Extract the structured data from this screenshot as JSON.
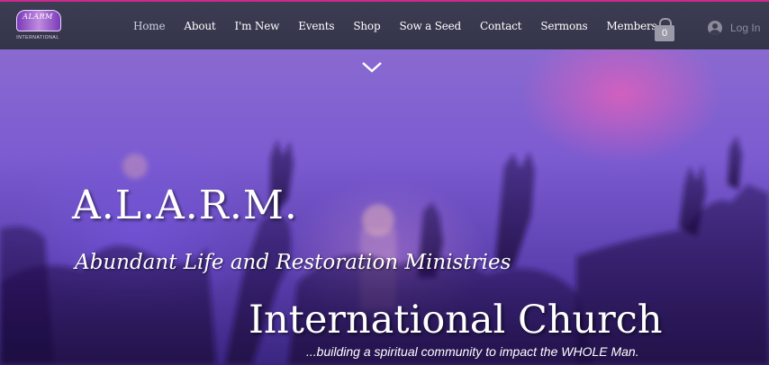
{
  "logo": {
    "text": "ALARM",
    "subtext": "INTERNATIONAL"
  },
  "nav": {
    "items": [
      {
        "label": "Home"
      },
      {
        "label": "About"
      },
      {
        "label": "I'm New"
      },
      {
        "label": "Events"
      },
      {
        "label": "Shop"
      },
      {
        "label": "Sow a Seed"
      },
      {
        "label": "Contact"
      },
      {
        "label": "Sermons"
      },
      {
        "label": "Members"
      }
    ],
    "active": "Home"
  },
  "cart": {
    "count": "0",
    "icon": "shopping-bag-icon"
  },
  "login": {
    "label": "Log In",
    "icon": "avatar-icon"
  },
  "hero": {
    "scroll_icon": "chevron-down-icon",
    "title": "A.L.A.R.M.",
    "subtitle": "Abundant Life and Restoration Ministries",
    "church": "International Church",
    "tagline": "...building a spiritual community to impact the WHOLE Man."
  },
  "colors": {
    "accent": "#c92a8c",
    "header_bg": "#3c3c52",
    "hero_purple": "#7b5bd0"
  }
}
